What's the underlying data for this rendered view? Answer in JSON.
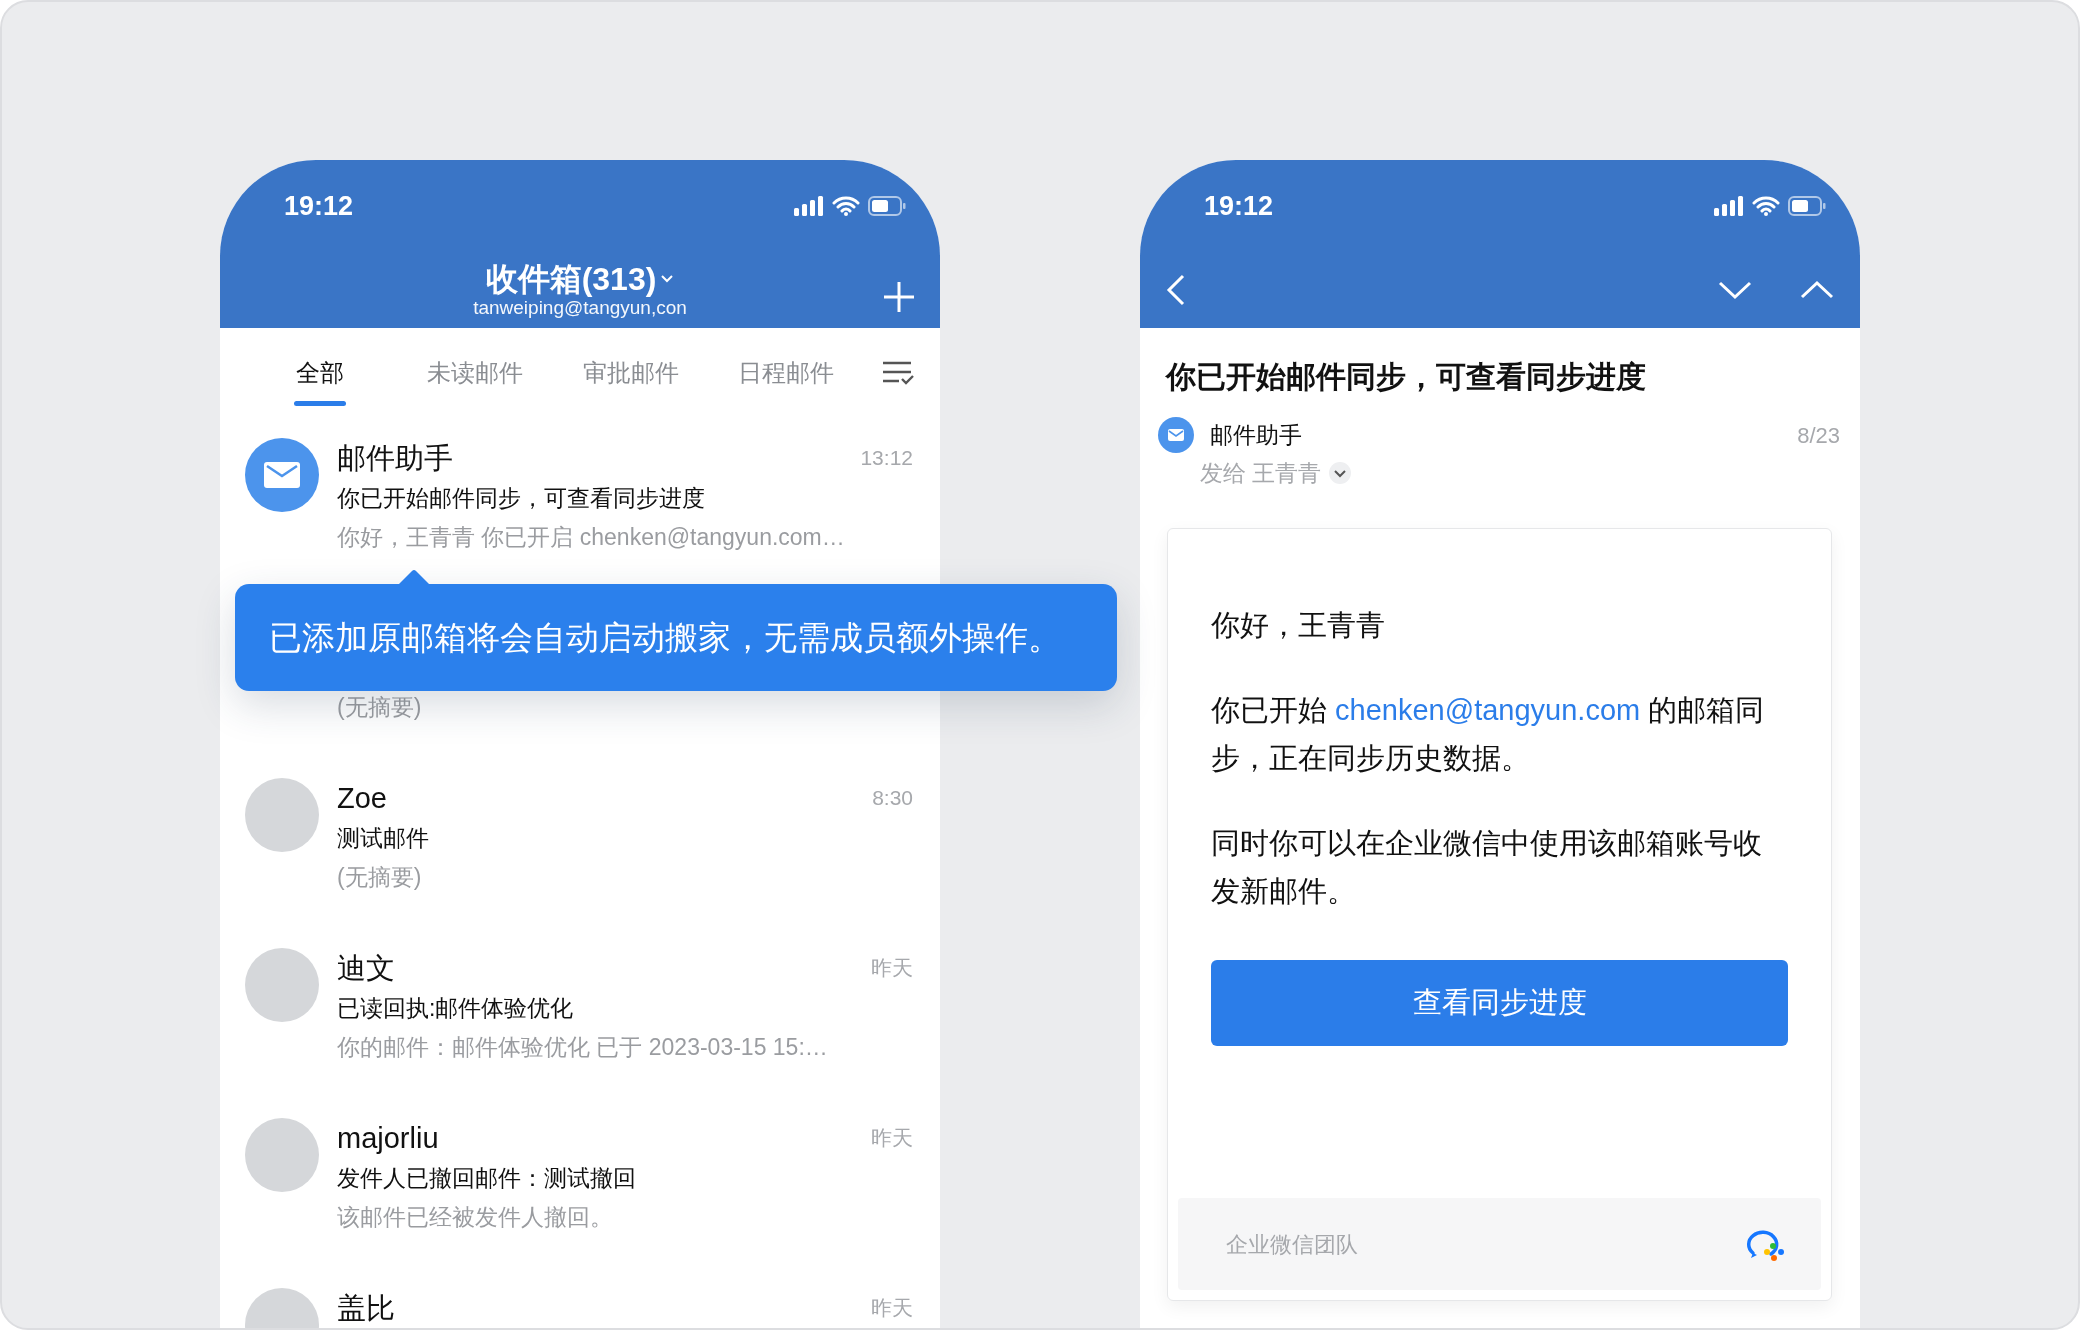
{
  "inbox_screen": {
    "status_time": "19:12",
    "title": "收件箱(313)",
    "account": "tanweiping@tangyun,con",
    "tabs": [
      {
        "label": "全部",
        "selected": true
      },
      {
        "label": "未读邮件",
        "selected": false
      },
      {
        "label": "审批邮件",
        "selected": false
      },
      {
        "label": "日程邮件",
        "selected": false
      }
    ],
    "mails": [
      {
        "kind": "app",
        "sender": "邮件助手",
        "time": "13:12",
        "subject": "你已开始邮件同步，可查看同步进度",
        "preview": "你好，王青青 你已开启 chenken@tangyun.com…"
      },
      {
        "preview": "(无摘要)"
      },
      {
        "kind": "photo",
        "sender": "Zoe",
        "time": "8:30",
        "subject": "测试邮件",
        "preview": "(无摘要)"
      },
      {
        "kind": "photo",
        "sender": "迪文",
        "time": "昨天",
        "subject": "已读回执:邮件体验优化",
        "preview": "你的邮件：邮件体验优化 已于 2023-03-15 15:…"
      },
      {
        "kind": "photo",
        "sender": "majorliu",
        "time": "昨天",
        "subject": "发件人已撤回邮件：测试撤回",
        "preview": "该邮件已经被发件人撤回。"
      },
      {
        "kind": "photo",
        "sender": "盖比",
        "time": "昨天"
      }
    ]
  },
  "tooltip": "已添加原邮箱将会自动启动搬家，无需成员额外操作。",
  "mail_screen": {
    "status_time": "19:12",
    "subject": "你已开始邮件同步，可查看同步进度",
    "sender": "邮件助手",
    "date": "8/23",
    "recipient": "发给 王青青",
    "body": [
      {
        "text": "你好，王青青"
      },
      {
        "before": "你已开始 ",
        "link": "chenken@tangyun.com",
        "after": " 的邮箱同步，正在同步历史数据。"
      },
      {
        "text": "同时你可以在企业微信中使用该邮箱账号收发新邮件。"
      }
    ],
    "button": "查看同步进度",
    "footer": "企业微信团队"
  }
}
